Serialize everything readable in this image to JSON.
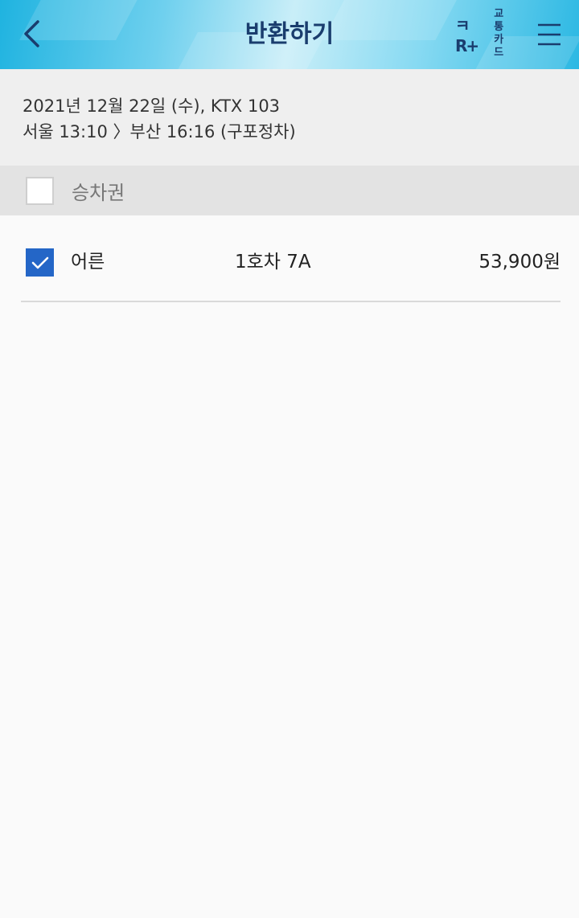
{
  "header": {
    "title": "반환하기",
    "logo_mark": "ㅋR+",
    "logo_line1": "교통",
    "logo_line2": "카드"
  },
  "trip": {
    "date_train": "2021년 12월 22일 (수), KTX 103",
    "route": "서울 13:10 〉부산 16:16 (구포정차)"
  },
  "ticket_list": {
    "select_all_label": "승차권",
    "select_all_checked": false,
    "tickets": [
      {
        "type": "어른",
        "seat": "1호차 7A",
        "price": "53,900원",
        "checked": true
      }
    ]
  },
  "colors": {
    "title": "#1a3d6e",
    "check_accent": "#2466c7",
    "info_bg": "#efefef",
    "select_all_bg": "#e3e3e3"
  },
  "icons": {
    "back": "chevron-left-icon",
    "menu": "hamburger-menu-icon",
    "check": "check-icon"
  }
}
